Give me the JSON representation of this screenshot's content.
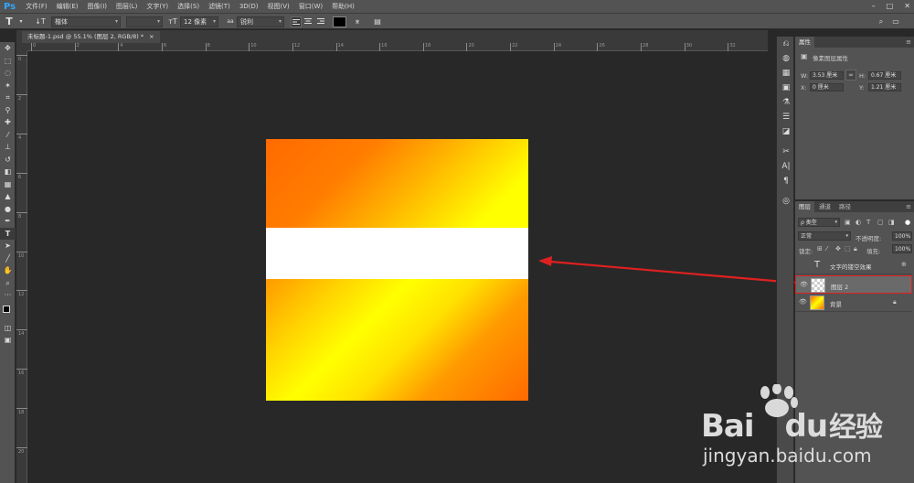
{
  "app": {
    "logo": "Ps",
    "menu": [
      "文件(F)",
      "编辑(E)",
      "图像(I)",
      "图层(L)",
      "文字(Y)",
      "选择(S)",
      "滤镜(T)",
      "3D(D)",
      "视图(V)",
      "窗口(W)",
      "帮助(H)"
    ],
    "window_controls": {
      "minimize": "–",
      "maximize": "□",
      "close": "✕"
    }
  },
  "options_bar": {
    "tool_glyph": "T",
    "font_family": "楷体",
    "font_size": "12 像素",
    "antialias": "锐利",
    "aa_symbol": "aa",
    "orient_symbol": "↓T"
  },
  "document": {
    "tab_title": "未标题-1.psd @ 55.1% (图层 2, RGB/8) *",
    "close_symbol": "×"
  },
  "rulers": {
    "top_numbers": [
      "0",
      "2",
      "4",
      "6",
      "8",
      "10",
      "12",
      "14",
      "16",
      "18",
      "20",
      "22",
      "24",
      "26",
      "28",
      "30",
      "32"
    ],
    "left_numbers": [
      "0",
      "2",
      "4",
      "6",
      "8",
      "10",
      "12",
      "14",
      "16",
      "18",
      "20"
    ]
  },
  "properties_panel": {
    "tab": "属性",
    "subtitle": "像素图层属性",
    "w_label": "W:",
    "w_value": "3.53 厘米",
    "h_label": "H:",
    "h_value": "0.67 厘米",
    "x_label": "X:",
    "x_value": "0 厘米",
    "y_label": "Y:",
    "y_value": "1.21 厘米",
    "link_symbol": "∞"
  },
  "layers_panel": {
    "tabs": [
      "图层",
      "通道",
      "路径"
    ],
    "kind_filter": "ρ 类型",
    "blend_mode": "正常",
    "opacity_label": "不透明度:",
    "opacity_value": "100%",
    "lock_label": "锁定:",
    "fill_label": "填充:",
    "fill_value": "100%",
    "layers": [
      {
        "name": "文字的镂空效果",
        "type": "text",
        "visible": false,
        "selected": false,
        "thumb_glyph": "T"
      },
      {
        "name": "图层 2",
        "type": "pixel",
        "visible": true,
        "selected": true
      },
      {
        "name": "背景",
        "type": "background",
        "visible": true,
        "selected": false
      }
    ]
  },
  "watermark": {
    "brand_latin_1": "Bai",
    "brand_latin_2": "du",
    "brand_cn": "经验",
    "url": "jingyan.baidu.com"
  },
  "colors": {
    "ui_bg": "#535353",
    "canvas_bg": "#282828",
    "highlight_red": "#e02020",
    "accent_blue": "#31a8ff",
    "gradient_orange": "#ff6a00",
    "gradient_yellow": "#ffff00"
  }
}
